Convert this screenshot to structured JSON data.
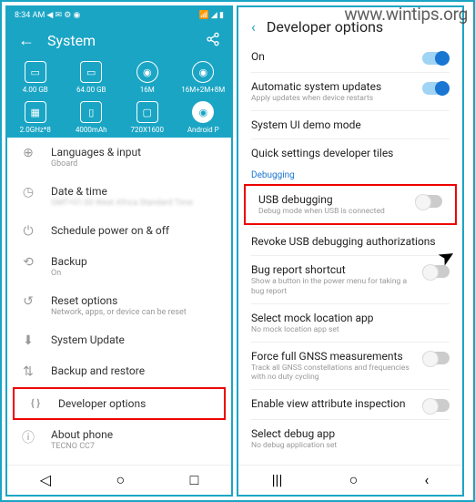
{
  "watermark": "www.wintips.org",
  "left": {
    "status": {
      "time": "8:34 AM",
      "icons_right": "⬚ ⬚ 📶 ⬚"
    },
    "header": {
      "title": "System"
    },
    "specs_row1": [
      {
        "icon": "RAM",
        "label": "4.00 GB"
      },
      {
        "icon": "ROM",
        "label": "64.00 GB"
      },
      {
        "icon": "⬚",
        "label": "16M"
      },
      {
        "icon": "⬚",
        "label": "16M+2M+8M"
      }
    ],
    "specs_row2": [
      {
        "icon": "CPU",
        "label": "2.0GHz*8"
      },
      {
        "icon": "⬚",
        "label": "4000mAh"
      },
      {
        "icon": "⬚",
        "label": "720X1600"
      },
      {
        "icon": "◉",
        "label": "Android P",
        "android": true
      }
    ],
    "items": [
      {
        "icon": "language-icon",
        "glyph": "⊕",
        "title": "Languages & input",
        "sub": "Gboard"
      },
      {
        "icon": "clock-icon",
        "glyph": "◷",
        "title": "Date & time",
        "sub": "GMT+01:00 West Africa Standard Time",
        "blur": true
      },
      {
        "icon": "power-icon",
        "glyph": "⏻",
        "title": "Schedule power on & off",
        "sub": ""
      },
      {
        "icon": "backup-icon",
        "glyph": "⟲",
        "title": "Backup",
        "sub": "On"
      },
      {
        "icon": "reset-icon",
        "glyph": "↺",
        "title": "Reset options",
        "sub": "Network, apps, or device can be reset"
      },
      {
        "icon": "update-icon",
        "glyph": "⬇",
        "title": "System Update",
        "sub": ""
      },
      {
        "icon": "restore-icon",
        "glyph": "⇅",
        "title": "Backup and restore",
        "sub": ""
      },
      {
        "icon": "developer-icon",
        "glyph": "{ }",
        "title": "Developer options",
        "sub": "",
        "highlight": true
      },
      {
        "icon": "info-icon",
        "glyph": "ⓘ",
        "title": "About phone",
        "sub": "TECNO CC7"
      }
    ]
  },
  "right": {
    "header": {
      "title": "Developer options"
    },
    "settings": [
      {
        "title": "On",
        "sub": "",
        "toggle": "on"
      },
      {
        "title": "Automatic system updates",
        "sub": "Apply updates when device restarts",
        "toggle": "on"
      },
      {
        "title": "System UI demo mode",
        "sub": ""
      },
      {
        "title": "Quick settings developer tiles",
        "sub": ""
      }
    ],
    "section_debugging": "Debugging",
    "usb_debugging": {
      "title": "USB debugging",
      "sub": "Debug mode when USB is connected",
      "toggle": "off"
    },
    "settings2": [
      {
        "title": "Revoke USB debugging authorizations",
        "sub": ""
      },
      {
        "title": "Bug report shortcut",
        "sub": "Show a button in the power menu for taking a bug report",
        "toggle": "off"
      },
      {
        "title": "Select mock location app",
        "sub": "No mock location app set"
      },
      {
        "title": "Force full GNSS measurements",
        "sub": "Track all GNSS constellations and frequencies with no duty cycling",
        "toggle": "off"
      },
      {
        "title": "Enable view attribute inspection",
        "sub": "",
        "toggle": "off"
      },
      {
        "title": "Select debug app",
        "sub": "No debug application set"
      }
    ]
  }
}
